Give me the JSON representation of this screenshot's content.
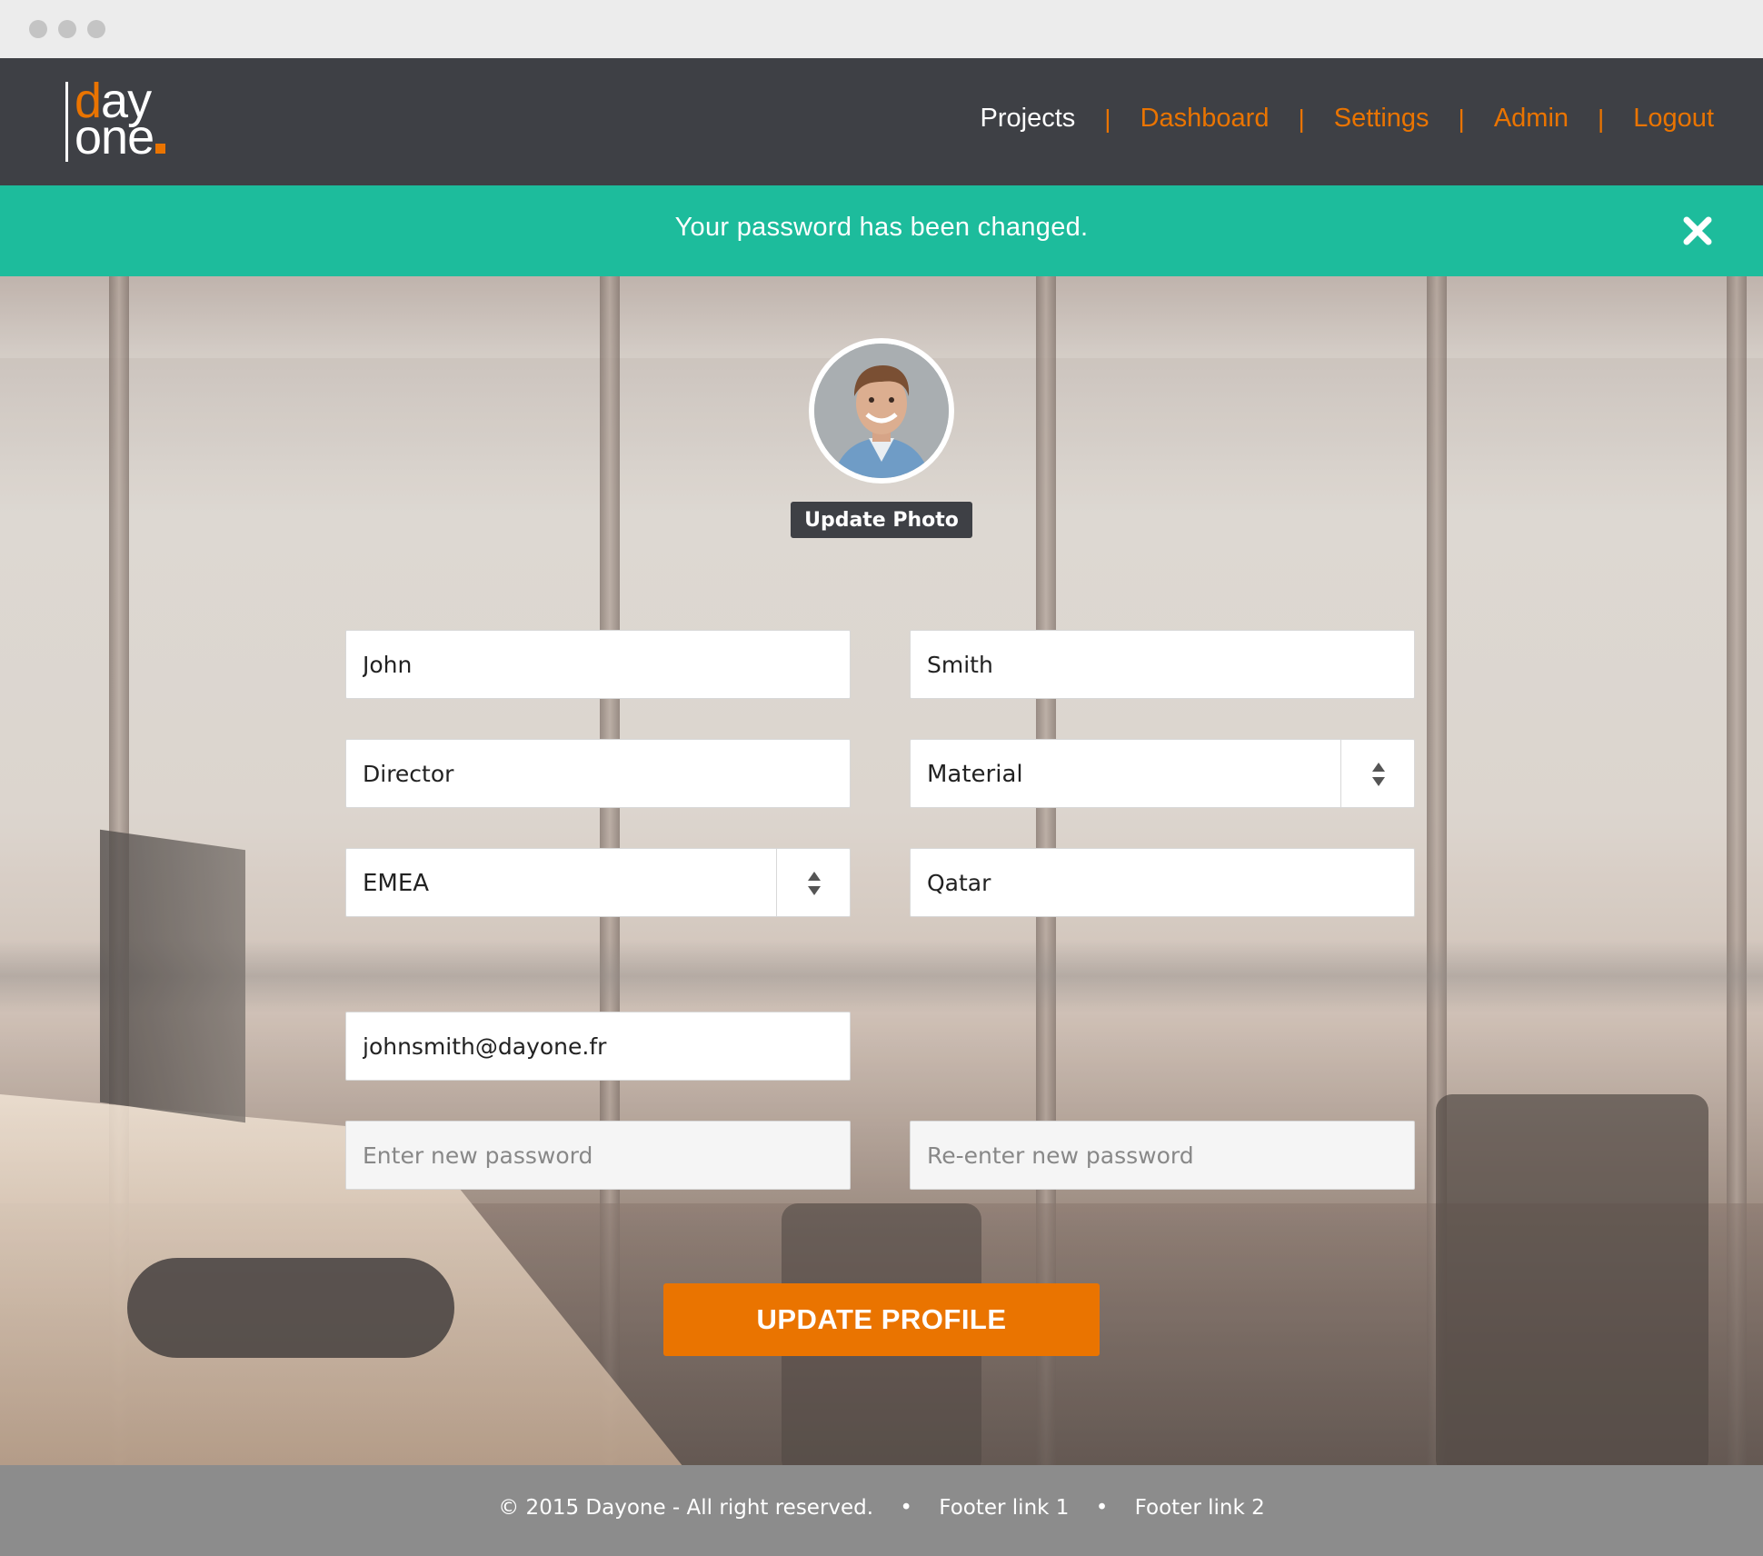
{
  "logo": {
    "word1_a": "d",
    "word1_b": "ay",
    "word2": "one"
  },
  "nav": {
    "items": [
      {
        "label": "Projects",
        "color": "#ffffff"
      },
      {
        "label": "Dashboard",
        "color": "#ea7400"
      },
      {
        "label": "Settings",
        "color": "#ea7400"
      },
      {
        "label": "Admin",
        "color": "#ea7400"
      },
      {
        "label": "Logout",
        "color": "#ea7400"
      }
    ],
    "separator": "|"
  },
  "alert": {
    "message": "Your password has been changed.",
    "close_icon": "close-icon",
    "color": "#1dbc9c"
  },
  "profile": {
    "update_photo_label": "Update Photo"
  },
  "form": {
    "first_name": "John",
    "last_name": "Smith",
    "title": "Director",
    "department": "Material",
    "region": "EMEA",
    "country": "Qatar",
    "email": "johnsmith@dayone.fr",
    "password_placeholder": "Enter new password",
    "password_confirm_placeholder": "Re-enter new password",
    "submit_label": "UPDATE PROFILE"
  },
  "footer": {
    "copyright": "© 2015 Dayone - All right reserved.",
    "bullet": "•",
    "link1": "Footer link 1",
    "link2": "Footer link 2"
  },
  "colors": {
    "accent": "#ea7400",
    "header_bg": "#3e4045",
    "footer_bg": "#8c8c8c"
  }
}
